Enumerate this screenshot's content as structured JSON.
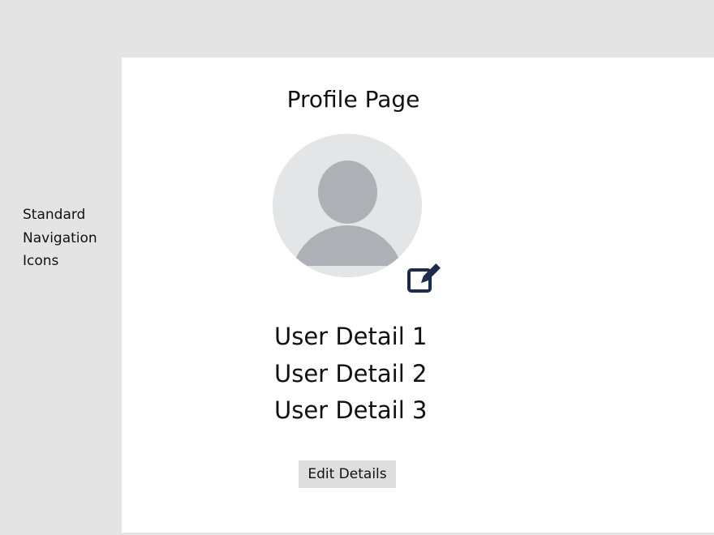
{
  "sidebar": {
    "nav_label": "Standard\nNavigation\nIcons"
  },
  "main": {
    "title": "Profile Page",
    "avatar_icon": "user-avatar-placeholder",
    "edit_icon": "pencil-square-icon",
    "details": [
      "User Detail 1",
      "User Detail 2",
      "User Detail 3"
    ],
    "edit_button_label": "Edit Details"
  },
  "colors": {
    "background": "#e4e4e4",
    "panel": "#ffffff",
    "avatar_bg": "#e4e5e7",
    "avatar_fg": "#adb0b4",
    "edit_icon": "#1d2c4a",
    "button_bg": "#dedede"
  }
}
